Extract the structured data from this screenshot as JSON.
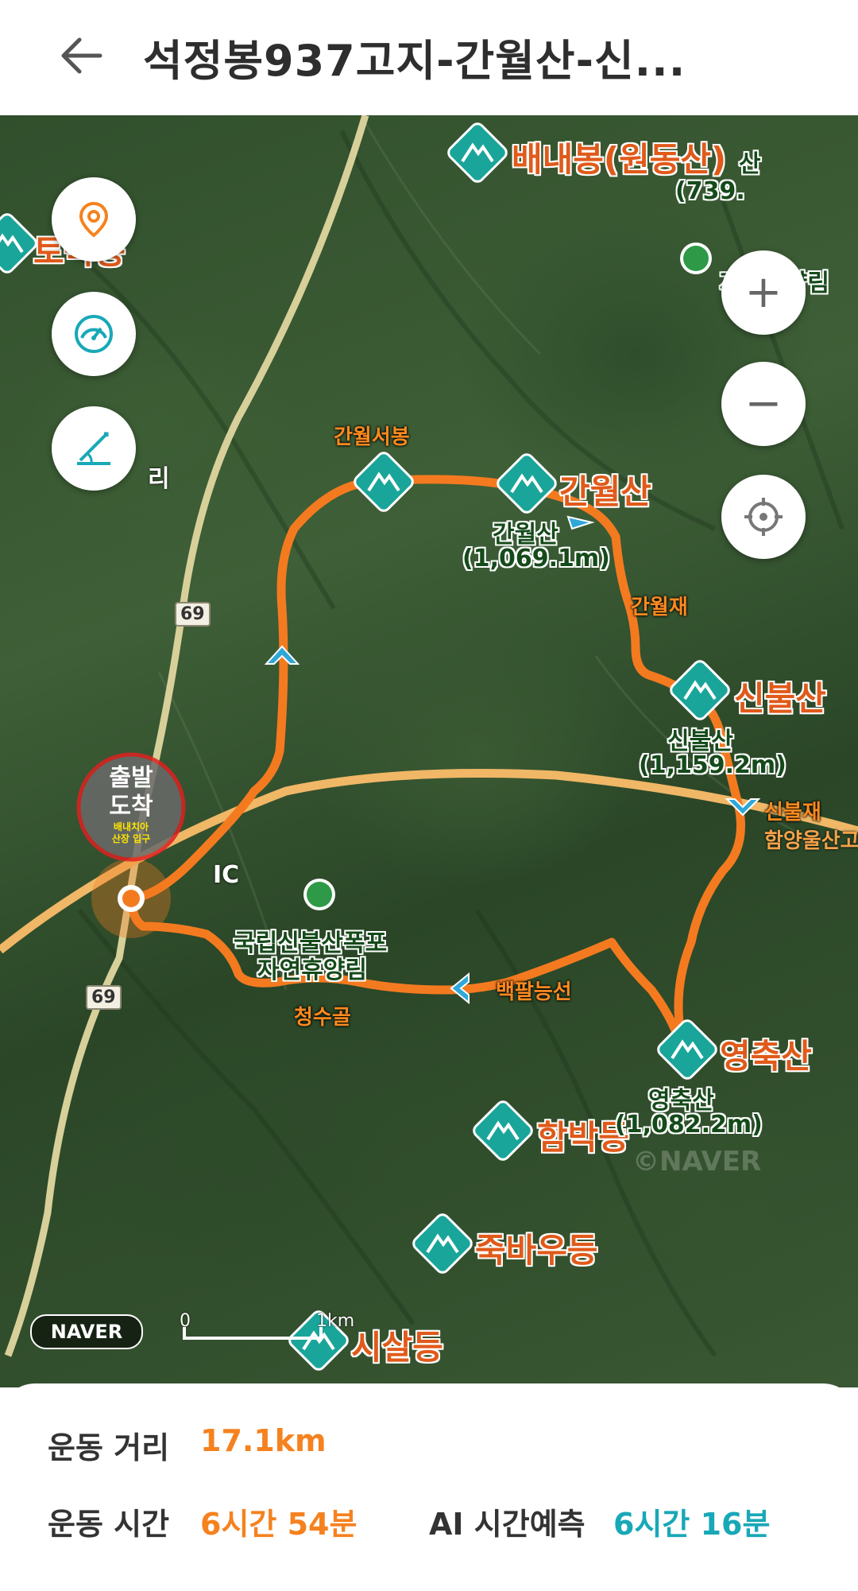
{
  "header": {
    "title": "석정봉937고지-간월산-신..."
  },
  "map": {
    "peaks": [
      {
        "label": "배내봉(원동산)"
      },
      {
        "label": "간월산"
      },
      {
        "label": "신불산"
      },
      {
        "label": "영축산"
      },
      {
        "label": "함박등"
      },
      {
        "label": "죽바우등"
      },
      {
        "label": "시살등"
      },
      {
        "label": "토곡봉"
      }
    ],
    "peak_names_small": {
      "ganwol": "간월산",
      "ganwol_elev": "(1,069.1m)",
      "sinbul": "신불산",
      "sinbul_elev": "(1,159.2m)",
      "yeongchuk": "영축산",
      "yeongchuk_elev": "(1,082.2m)",
      "right_edge_a": "산",
      "right_edge_b": "(739.",
      "forest_right": "자연휴양림"
    },
    "waypoints": {
      "ganwolseobong": "간월서봉",
      "ganwoljae": "간월재",
      "sinbuljae": "신불재",
      "baekpal": "백팔능선",
      "cheongsu": "청수골"
    },
    "places": {
      "ic": "IC",
      "village": "리",
      "forest": "국립신불산폭포",
      "forest2": "자연휴양림",
      "road_name": "함양울산고"
    },
    "road_numbers": [
      "69",
      "69"
    ],
    "start_marker": {
      "line1": "출발",
      "line2": "도착",
      "line3": "배내치아",
      "line4": "산장 입구"
    },
    "scale": {
      "zero": "0",
      "km": "1km"
    },
    "naver_logo": "NAVER",
    "watermark": "©NAVER",
    "colors": {
      "route": "#f47a20",
      "peak_icon": "#1aa59a",
      "start_circle": "#e02020"
    },
    "zoom_in": "+",
    "zoom_out": "−"
  },
  "stats": {
    "distance_label": "운동 거리",
    "distance_value": "17.1km",
    "time_label": "운동 시간",
    "time_value": "6시간 54분",
    "ai_label": "AI 시간예측",
    "ai_value": "6시간 16분",
    "accent_orange": "#f5821f",
    "accent_teal": "#18a8b8"
  }
}
